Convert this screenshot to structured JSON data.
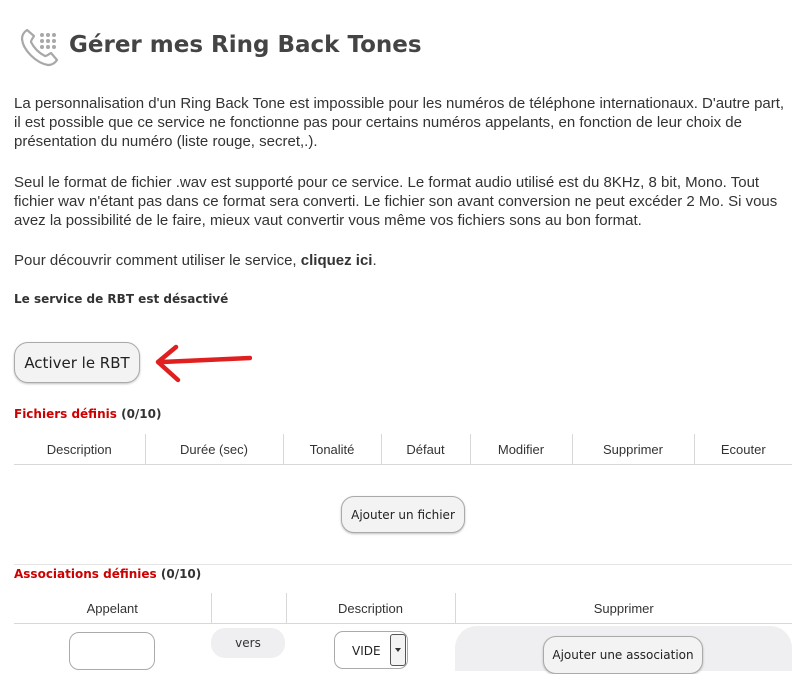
{
  "header": {
    "title": "Gérer mes Ring Back Tones",
    "icon": "phone-icon"
  },
  "intro": {
    "para1": "La personnalisation d'un Ring Back Tone est impossible pour les numéros de téléphone internationaux. D'autre part, il est possible que ce service ne fonctionne pas pour certains numéros appelants, en fonction de leur choix de présentation du numéro (liste rouge, secret,.).",
    "para2": "Seul le format de fichier .wav est supporté pour ce service. Le format audio utilisé est du 8KHz, 8 bit, Mono. Tout fichier wav n'étant pas dans ce format sera converti. Le fichier son avant conversion ne peut excéder 2 Mo. Si vous avez la possibilité de le faire, mieux vaut convertir vous même vos fichiers sons au bon format.",
    "para3_prefix": "Pour découvrir comment utiliser le service, ",
    "para3_link": "cliquez ici",
    "para3_suffix": "."
  },
  "status_text": "Le service de RBT est désactivé",
  "activate_label": "Activer le RBT",
  "annotation_arrow_color": "#e02020",
  "files_section": {
    "title": "Fichiers définis",
    "count": "(0/10)",
    "columns": [
      "Description",
      "Durée (sec)",
      "Tonalité",
      "Défaut",
      "Modifier",
      "Supprimer",
      "Ecouter"
    ],
    "add_label": "Ajouter un fichier"
  },
  "assoc_section": {
    "title": "Associations définies",
    "count": "(0/10)",
    "columns": [
      "Appelant",
      "",
      "Description",
      "Supprimer"
    ],
    "caller_value": "",
    "vers_label": "vers",
    "description_value": "VIDE",
    "add_label": "Ajouter une association"
  },
  "colors": {
    "section_title": "#cc0000",
    "text": "#333333"
  }
}
